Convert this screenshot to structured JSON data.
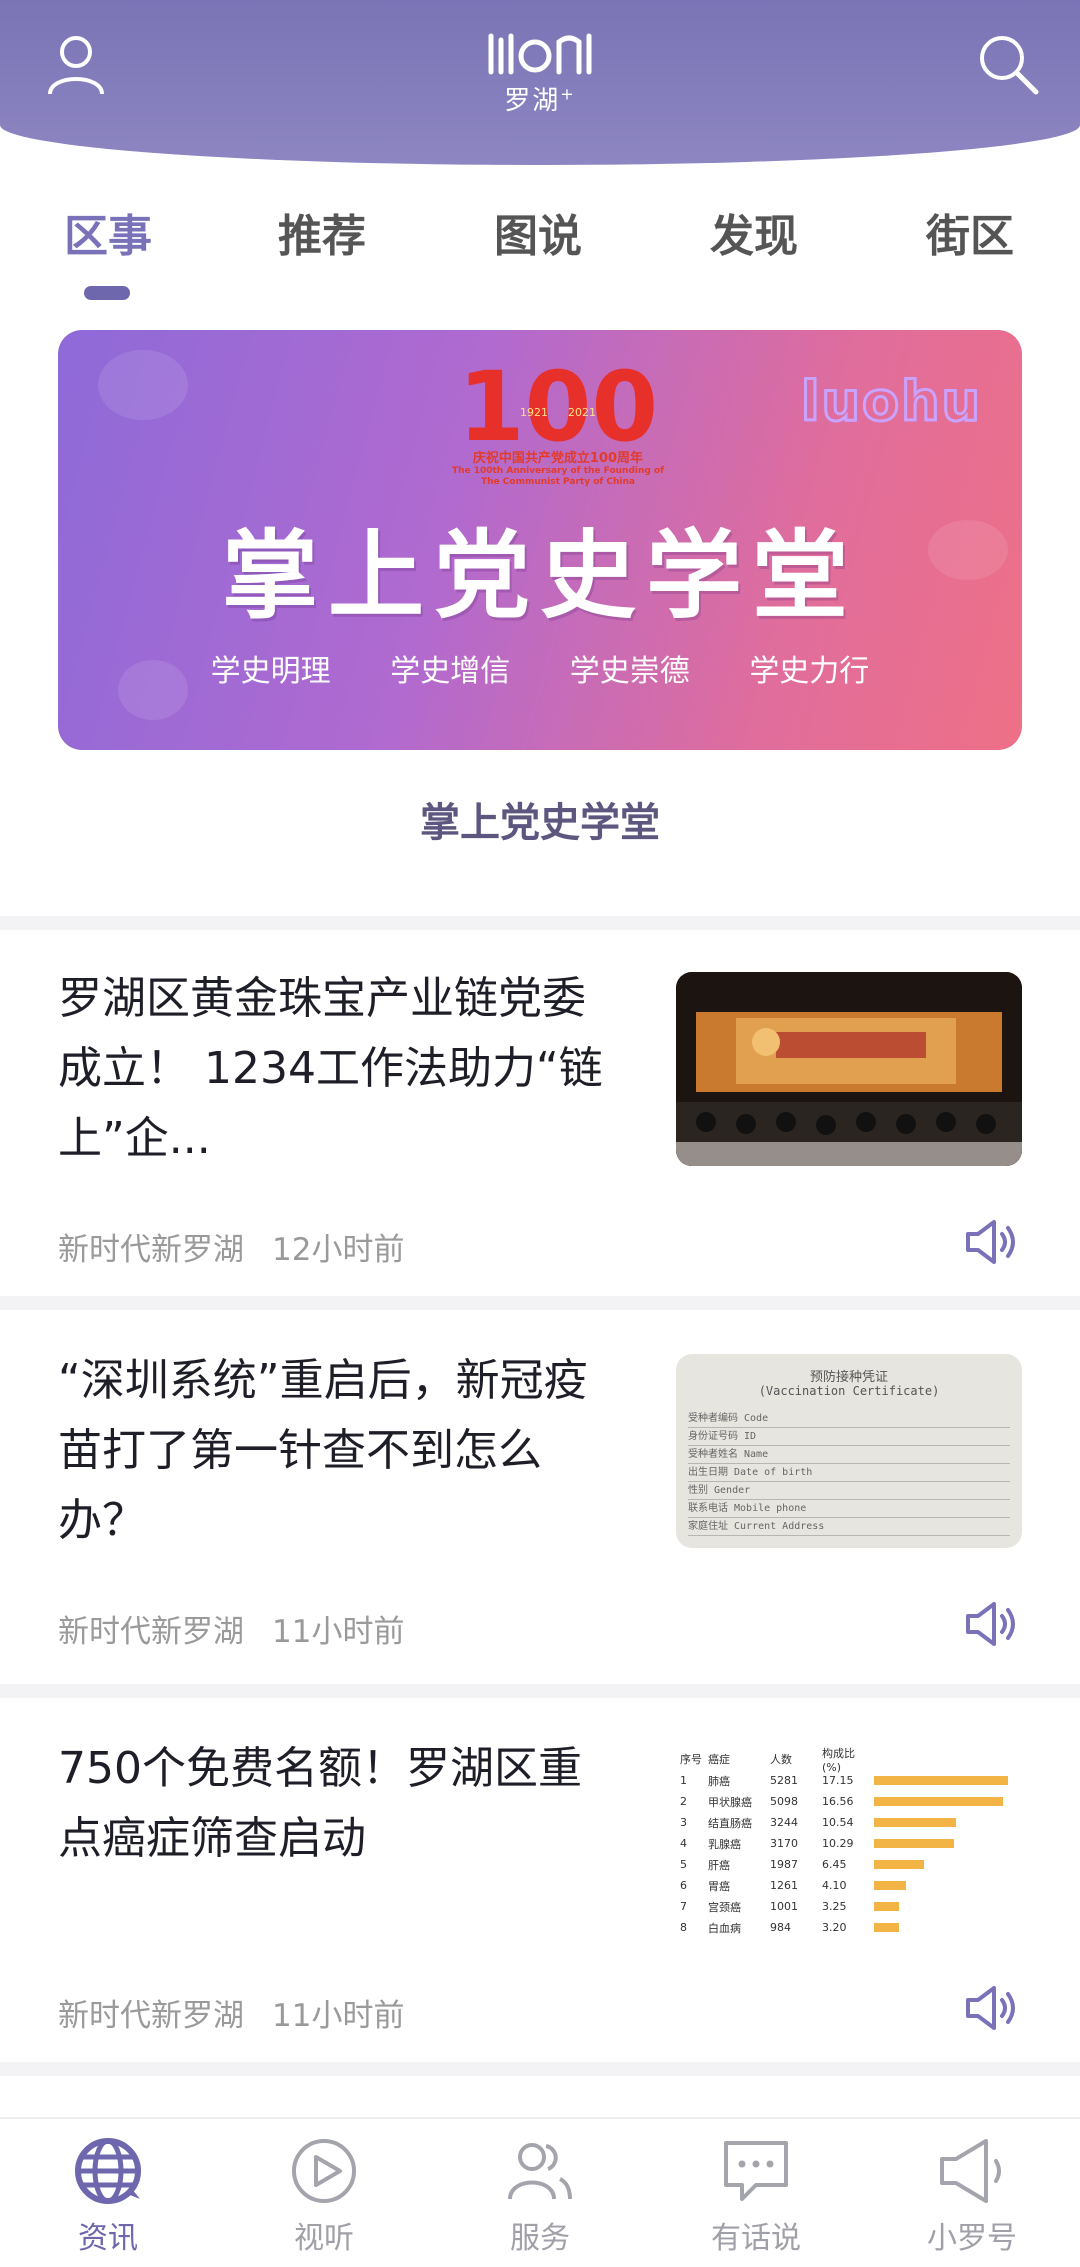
{
  "header": {
    "logo_text": "罗湖",
    "logo_sup": "+"
  },
  "tabs": [
    {
      "label": "区事",
      "active": true
    },
    {
      "label": "推荐",
      "active": false
    },
    {
      "label": "图说",
      "active": false
    },
    {
      "label": "发现",
      "active": false
    },
    {
      "label": "街区",
      "active": false
    }
  ],
  "banner": {
    "badge_number": "100",
    "badge_years_left": "1921",
    "badge_years_right": "2021",
    "badge_caption_cn": "庆祝中国共产党成立100周年",
    "badge_caption_en": "The 100th Anniversary of the Founding of The Communist Party of China",
    "brand": "luohu",
    "title": "掌上党史学堂",
    "slogans": [
      "学史明理",
      "学史增信",
      "学史崇德",
      "学史力行"
    ],
    "caption": "掌上党史学堂"
  },
  "news": [
    {
      "title": "罗湖区黄金珠宝产业链党委成立！ 1234工作法助力“链上”企...",
      "source": "新时代新罗湖",
      "time": "12小时前",
      "thumb": "conference-stage-photo"
    },
    {
      "title": "“深圳系统”重启后，新冠疫苗打了第一针查不到怎么办？",
      "source": "新时代新罗湖",
      "time": "11小时前",
      "thumb": "vaccination-certificate-photo",
      "thumb_text": {
        "title_cn": "预防接种凭证",
        "title_en": "(Vaccination Certificate)",
        "rows": [
          "受种者编码 Code",
          "身份证号码 ID",
          "受种者姓名 Name",
          "出生日期 Date of birth",
          "性别 Gender",
          "联系电话 Mobile phone",
          "家庭住址 Current Address"
        ]
      }
    },
    {
      "title": "750个免费名额！罗湖区重点癌症筛查启动",
      "source": "新时代新罗湖",
      "time": "11小时前",
      "thumb": "cancer-statistics-table",
      "thumb_table": {
        "headers": [
          "序号",
          "癌症",
          "人数",
          "构成比(%)"
        ],
        "rows": [
          {
            "no": "1",
            "name": "肺癌",
            "count": "5281",
            "pct": "17.15",
            "val": 17.15
          },
          {
            "no": "2",
            "name": "甲状腺癌",
            "count": "5098",
            "pct": "16.56",
            "val": 16.56
          },
          {
            "no": "3",
            "name": "结直肠癌",
            "count": "3244",
            "pct": "10.54",
            "val": 10.54
          },
          {
            "no": "4",
            "name": "乳腺癌",
            "count": "3170",
            "pct": "10.29",
            "val": 10.29
          },
          {
            "no": "5",
            "name": "肝癌",
            "count": "1987",
            "pct": "6.45",
            "val": 6.45
          },
          {
            "no": "6",
            "name": "胃癌",
            "count": "1261",
            "pct": "4.10",
            "val": 4.1
          },
          {
            "no": "7",
            "name": "宫颈癌",
            "count": "1001",
            "pct": "3.25",
            "val": 3.25
          },
          {
            "no": "8",
            "name": "白血病",
            "count": "984",
            "pct": "3.20",
            "val": 3.2
          }
        ]
      }
    }
  ],
  "bottom_nav": [
    {
      "label": "资讯",
      "icon": "globe-icon",
      "active": true
    },
    {
      "label": "视听",
      "icon": "play-icon",
      "active": false
    },
    {
      "label": "服务",
      "icon": "people-icon",
      "active": false
    },
    {
      "label": "有话说",
      "icon": "chat-icon",
      "active": false
    },
    {
      "label": "小罗号",
      "icon": "megaphone-icon",
      "active": false
    }
  ],
  "colors": {
    "header": "#7b74b5",
    "accent": "#6e67ad"
  }
}
